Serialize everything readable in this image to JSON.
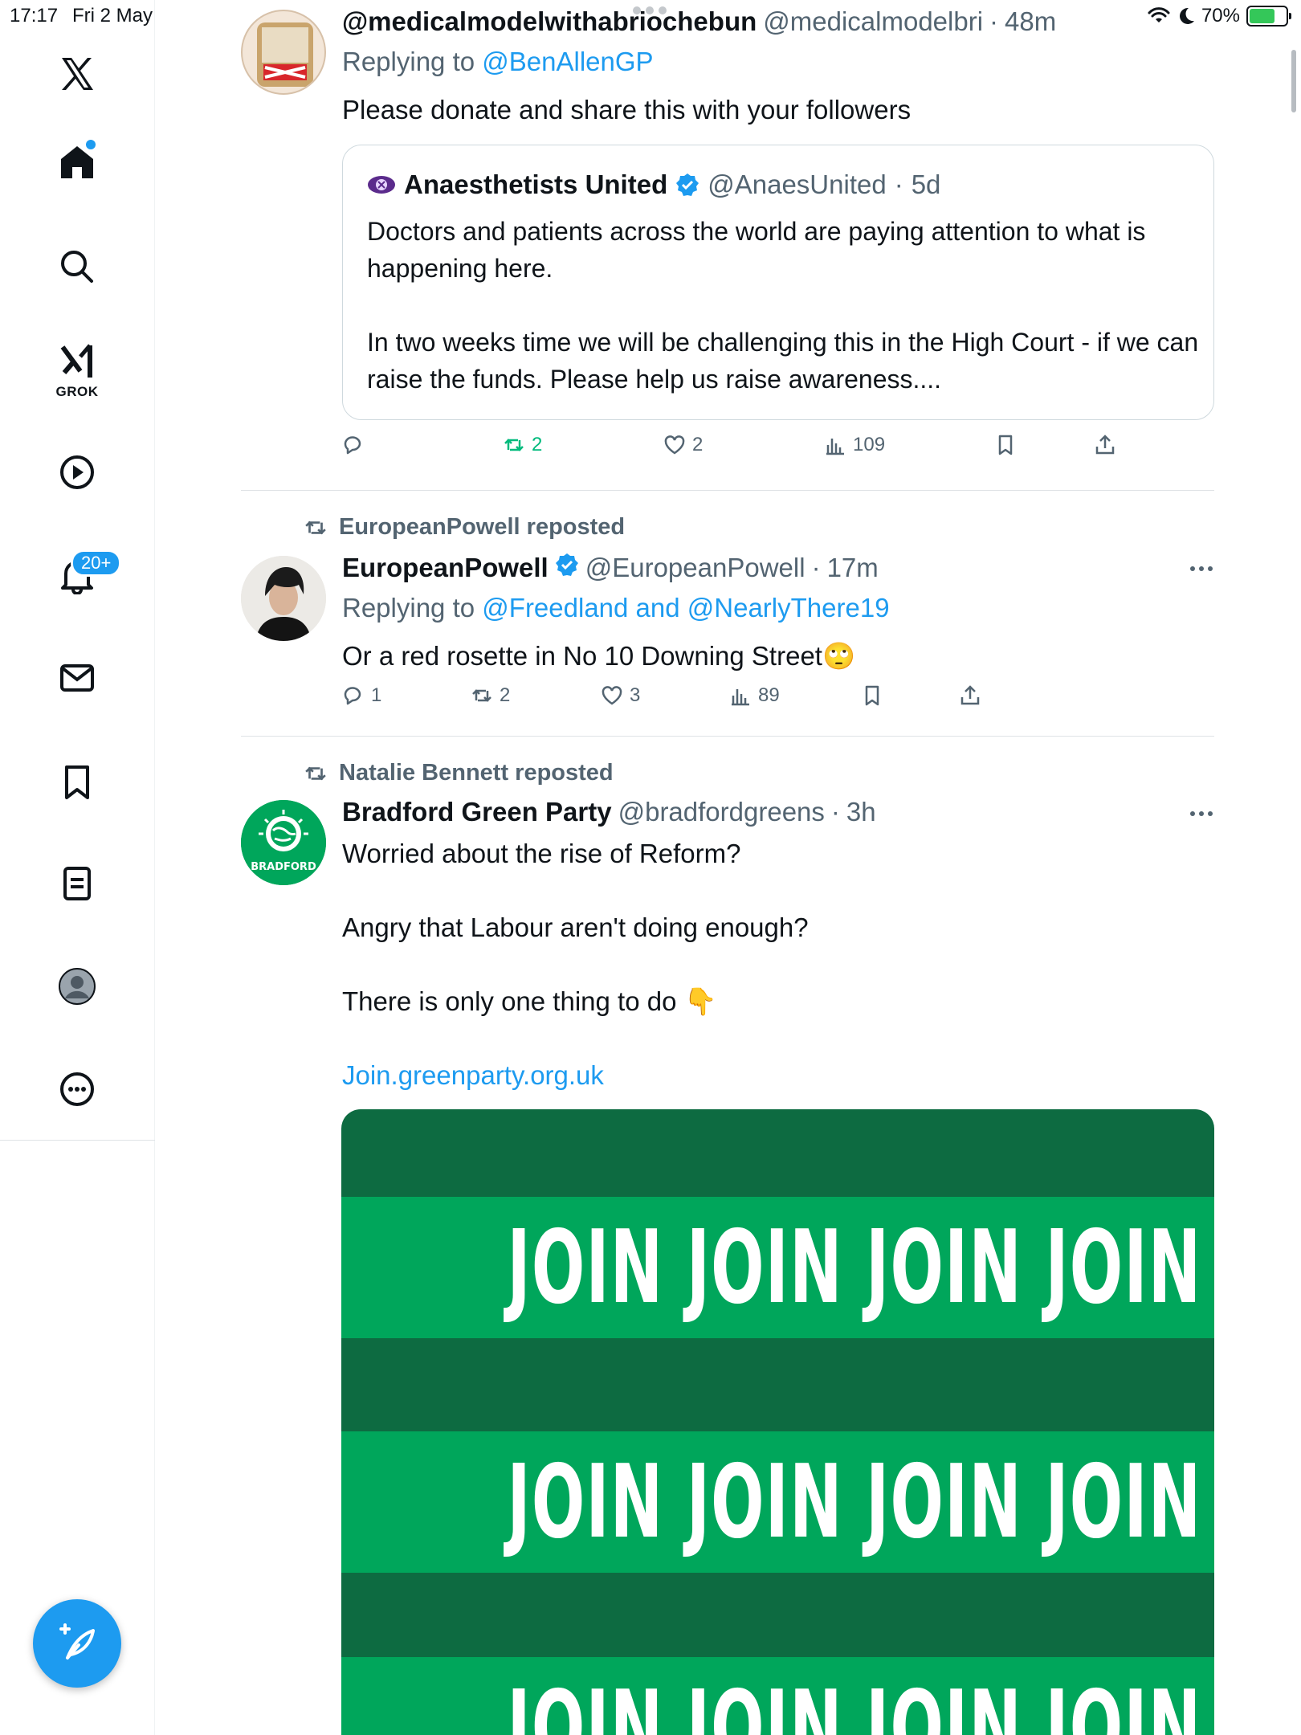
{
  "status_bar": {
    "time": "17:17",
    "date": "Fri 2 May",
    "battery": "70%",
    "battery_level": 0.7
  },
  "sidebar": {
    "grok_label": "GROK",
    "notifications_badge": "20+"
  },
  "tweets": [
    {
      "name": "@medicalmodelwithabriochebun",
      "handle": "@medicalmodelbri",
      "time": "48m",
      "replying_prefix": "Replying to",
      "replying_to": "@BenAllenGP",
      "text": "Please donate and share this with your followers",
      "quote": {
        "name": "Anaesthetists United",
        "handle": "@AnaesUnited",
        "time": "5d",
        "paragraphs": [
          "Doctors and patients across the world are paying attention to what is happening here.",
          "In two weeks time we will be challenging this in the High Court - if we can raise the funds. Please help us raise awareness...."
        ]
      },
      "stats": {
        "replies": "",
        "reposts": "2",
        "likes": "2",
        "views": "109"
      },
      "reposted_by_me": true
    },
    {
      "repost_label": "EuropeanPowell reposted",
      "name": "EuropeanPowell",
      "handle": "@EuropeanPowell",
      "time": "17m",
      "replying_prefix": "Replying to",
      "replying_to": "@Freedland and @NearlyThere19",
      "text": "Or a red rosette in No 10 Downing Street🙄",
      "stats": {
        "replies": "1",
        "reposts": "2",
        "likes": "3",
        "views": "89"
      }
    },
    {
      "repost_label": "Natalie Bennett reposted",
      "name": "Bradford Green Party",
      "handle": "@bradfordgreens",
      "time": "3h",
      "paragraphs": [
        "Worried about the rise of Reform?",
        "Angry that Labour aren't doing enough?",
        "There is only one thing to do 👇"
      ],
      "link": "Join.greenparty.org.uk",
      "avatar_label": "BRADFORD",
      "media_text": "JOIN JOIN JOIN JOIN"
    }
  ],
  "colors": {
    "accent": "#1d9bf0",
    "repost_green": "#00ba7c",
    "green_party_dark": "#0d6b41",
    "green_party_light": "#00a65b"
  }
}
